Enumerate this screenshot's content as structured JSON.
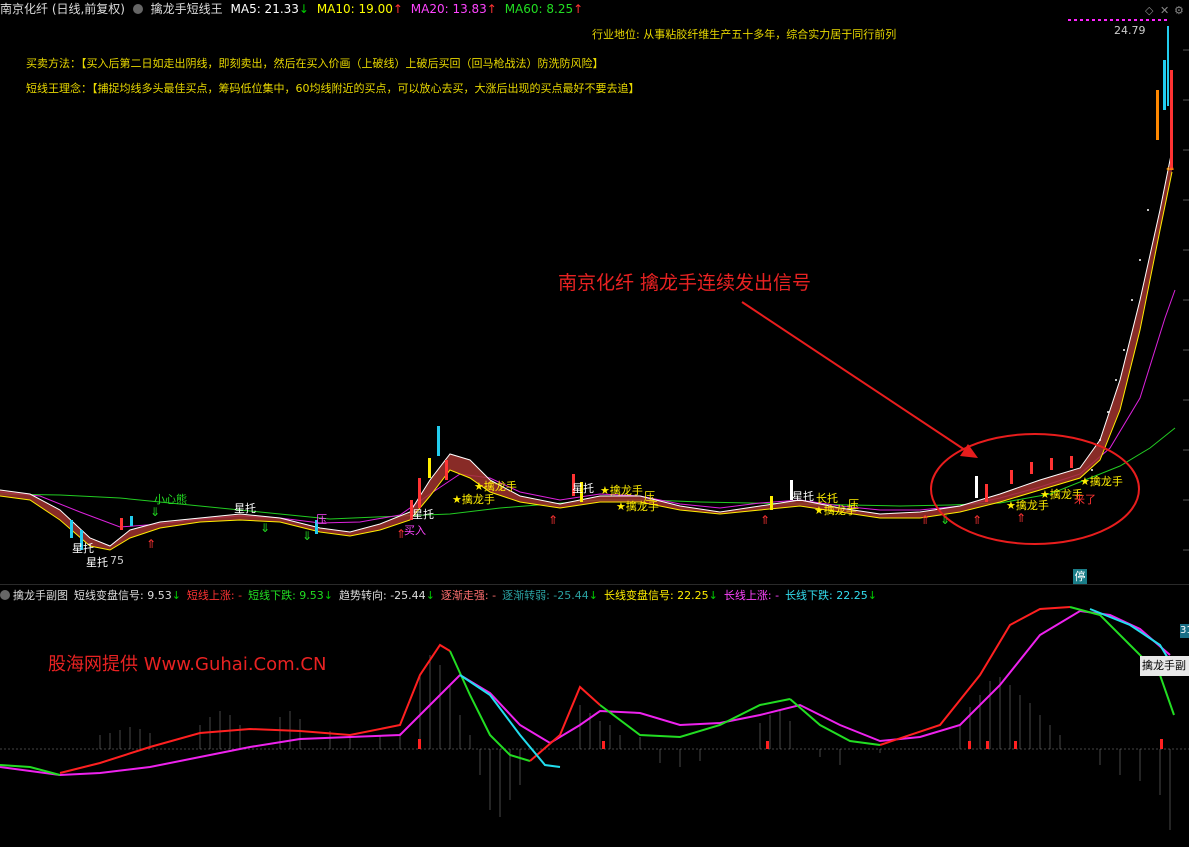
{
  "header": {
    "stock": "南京化纤 (日线,前复权)",
    "indicator": "擒龙手短线王",
    "ma5": "MA5: 21.33",
    "ma5_arrow": "↓",
    "ma10": "MA10: 19.00",
    "ma10_arrow": "↑",
    "ma20": "MA20: 13.83",
    "ma20_arrow": "↑",
    "ma60": "MA60: 8.25",
    "ma60_arrow": "↑"
  },
  "info": {
    "industry": "行业地位: 从事粘胶纤维生产五十多年，综合实力居于同行前列",
    "method": "买卖方法：【买入后第二日如走出阴线，即刻卖出，然后在买入价画（上破线）上破后买回（回马枪战法）防洗防风险】",
    "philosophy": "短线王理念：【捕捉均线多头最佳买点，筹码低位集中，60均线附近的买点，可以放心去买，大涨后出现的买点最好不要去追】"
  },
  "price_labels": {
    "high": "24.79",
    "low": "75",
    "low_prefix": "星托"
  },
  "annotation": {
    "callout": "南京化纤  擒龙手连续发出信号"
  },
  "signals": [
    {
      "text": "小心熊"
    },
    {
      "text": "星托"
    },
    {
      "text": "压"
    },
    {
      "text": "星托"
    },
    {
      "text": "星托"
    },
    {
      "text": "买入"
    },
    {
      "text": "★擒龙手"
    },
    {
      "text": "★擒龙手"
    },
    {
      "text": "星托"
    },
    {
      "text": "★擒龙手"
    },
    {
      "text": "压"
    },
    {
      "text": "★擒龙手"
    },
    {
      "text": "星托"
    },
    {
      "text": "长托"
    },
    {
      "text": "压"
    },
    {
      "text": "★擒龙手"
    },
    {
      "text": "★擒龙手"
    },
    {
      "text": "★擒龙手"
    },
    {
      "text": "★擒龙手"
    },
    {
      "text": "来了"
    }
  ],
  "sub_header": {
    "name": "擒龙手副图",
    "short_signal": "短线变盘信号: 9.53",
    "short_signal_arrow": "↓",
    "short_up": "短线上涨: -",
    "short_down": "短线下跌: 9.53",
    "short_down_arrow": "↓",
    "trend_turn": "趋势转向: -25.44",
    "trend_turn_arrow": "↓",
    "gradual_strong": "逐渐走强: -",
    "gradual_weak": "逐渐转弱: -25.44",
    "gradual_weak_arrow": "↓",
    "long_signal": "长线变盘信号: 22.25",
    "long_signal_arrow": "↓",
    "long_up": "长线上涨: -",
    "long_down": "长线下跌: 22.25",
    "long_down_arrow": "↓"
  },
  "watermark": "股海网提供 Www.Guhai.Com.CN",
  "side_box": "擒龙手副",
  "side_value": "31",
  "tag": "停",
  "colors": {
    "ma5": "#ffffff",
    "ma10": "#ffff00",
    "ma20": "#ff00ff",
    "ma60": "#00ff00",
    "red": "#ff2020",
    "yellow": "#ffd700",
    "cyan": "#00e5ff",
    "band": "#a0322e"
  }
}
